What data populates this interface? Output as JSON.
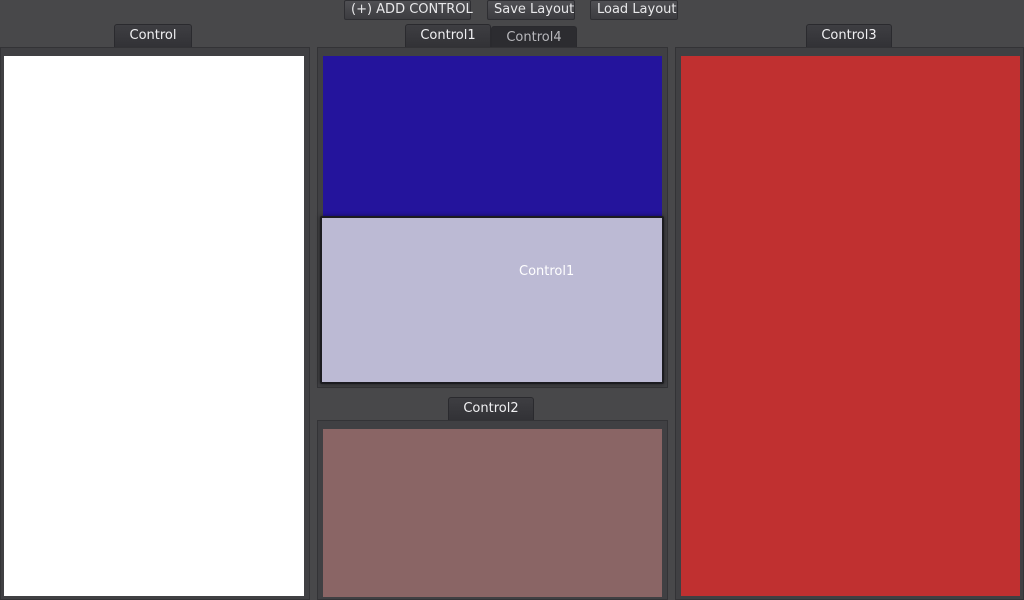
{
  "toolbar": {
    "add_label": "(+) ADD CONTROL",
    "save_label": "Save Layout",
    "load_label": "Load Layout"
  },
  "panels": {
    "left": {
      "tab": "Control",
      "color": "#ffffff"
    },
    "top_center": {
      "active_tab": "Control1",
      "inactive_tab": "Control4",
      "color": "#24149c"
    },
    "bottom_center": {
      "tab": "Control2",
      "color": "#8a6565"
    },
    "right": {
      "tab": "Control3",
      "color": "#c03030"
    }
  },
  "drag_preview": {
    "label": "Control1",
    "color": "#bcbad4"
  }
}
